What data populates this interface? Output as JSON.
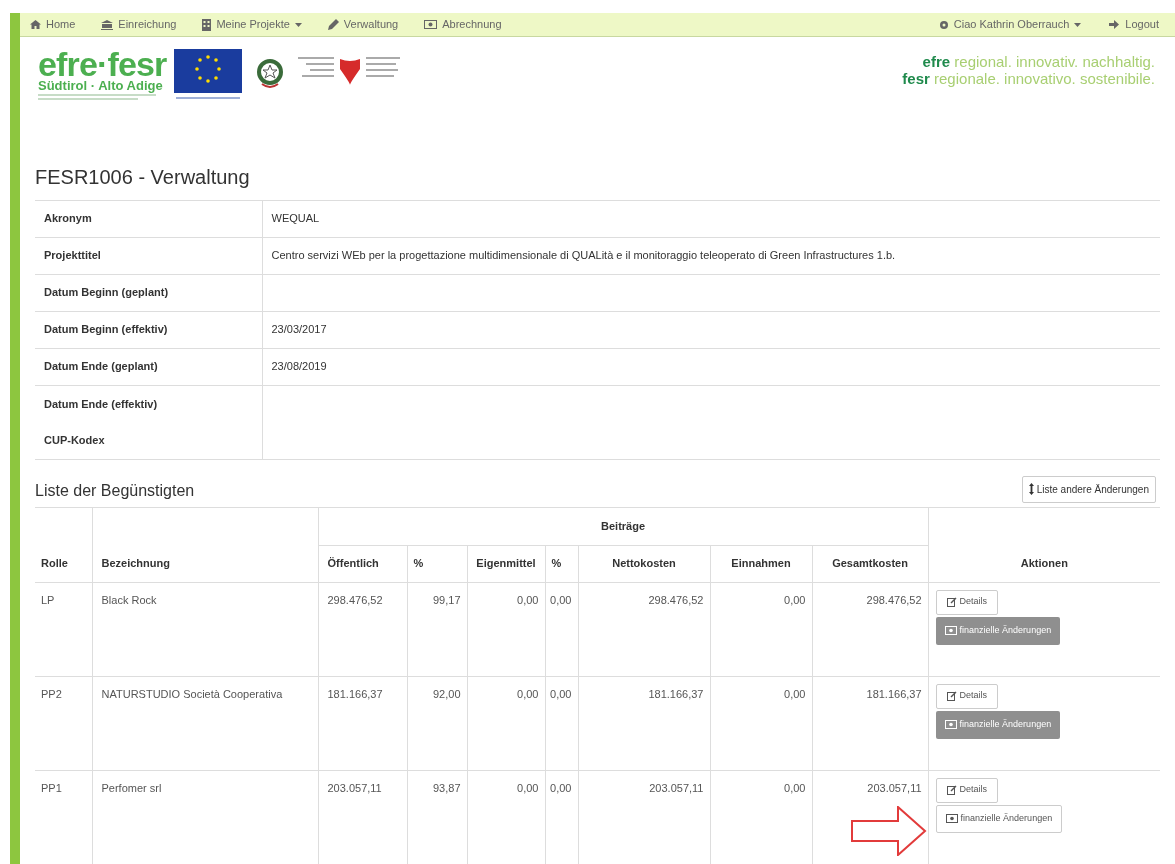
{
  "navbar": {
    "items": [
      {
        "label": "Home",
        "dropdown": false
      },
      {
        "label": "Einreichung",
        "dropdown": false
      },
      {
        "label": "Meine Projekte",
        "dropdown": true
      },
      {
        "label": "Verwaltung",
        "dropdown": false
      },
      {
        "label": "Abrechnung",
        "dropdown": false
      }
    ],
    "right": [
      {
        "label": "Ciao Kathrin Oberrauch",
        "dropdown": true
      },
      {
        "label": "Logout",
        "dropdown": false
      }
    ]
  },
  "logo": {
    "name": "efre·fesr",
    "region": "Südtirol · Alto Adige"
  },
  "tagline": [
    "**efre** regional. innovativ. nachhaltig.",
    "**fesr** regionale. innovativo. sostenibile."
  ],
  "page_title": "FESR1006 - Verwaltung",
  "info": [
    {
      "label": "Akronym",
      "value": "WEQUAL"
    },
    {
      "label": "Projekttitel",
      "value": "Centro servizi WEb per la progettazione multidimensionale di QUALità e il monitoraggio teleoperato di Green Infrastructures 1.b."
    },
    {
      "label": "Datum Beginn (geplant)"
    },
    {
      "label": "Datum Beginn (effektiv)",
      "value": "23/03/2017"
    },
    {
      "label": "Datum Ende (geplant)",
      "value": "23/08/2019"
    },
    {
      "label": "Datum Ende (effektiv)"
    },
    {
      "label": "CUP-Kodex"
    }
  ],
  "beneficiaries": {
    "title": "Liste der Begünstigten",
    "list_button": "Liste andere Änderungen",
    "group_header": "Beiträge",
    "columns": [
      "Rolle",
      "Bezeichnung",
      "Öffentlich",
      "%",
      "Eigenmittel",
      "%",
      "Nettokosten",
      "Einnahmen",
      "Gesamtkosten",
      "Aktionen"
    ],
    "rows": [
      {
        "cells": [
          "LP",
          "Black Rock",
          "298.476,52",
          "99,17",
          "0,00",
          "0,00",
          "298.476,52",
          "0,00",
          "298.476,52"
        ],
        "details": "Details",
        "finance": "finanzielle Änderungen",
        "finance_disabled": true
      },
      {
        "cells": [
          "PP2",
          "NATURSTUDIO Società Cooperativa",
          "181.166,37",
          "92,00",
          "0,00",
          "0,00",
          "181.166,37",
          "0,00",
          "181.166,37"
        ],
        "details": "Details",
        "finance": "finanzielle Änderungen",
        "finance_disabled": true
      },
      {
        "cells": [
          "PP1",
          "Perfomer srl",
          "203.057,11",
          "93,87",
          "0,00",
          "0,00",
          "203.057,11",
          "0,00",
          "203.057,11"
        ],
        "details": "Details",
        "finance": "finanzielle Änderungen",
        "finance_disabled": false,
        "arrow": true
      }
    ]
  }
}
